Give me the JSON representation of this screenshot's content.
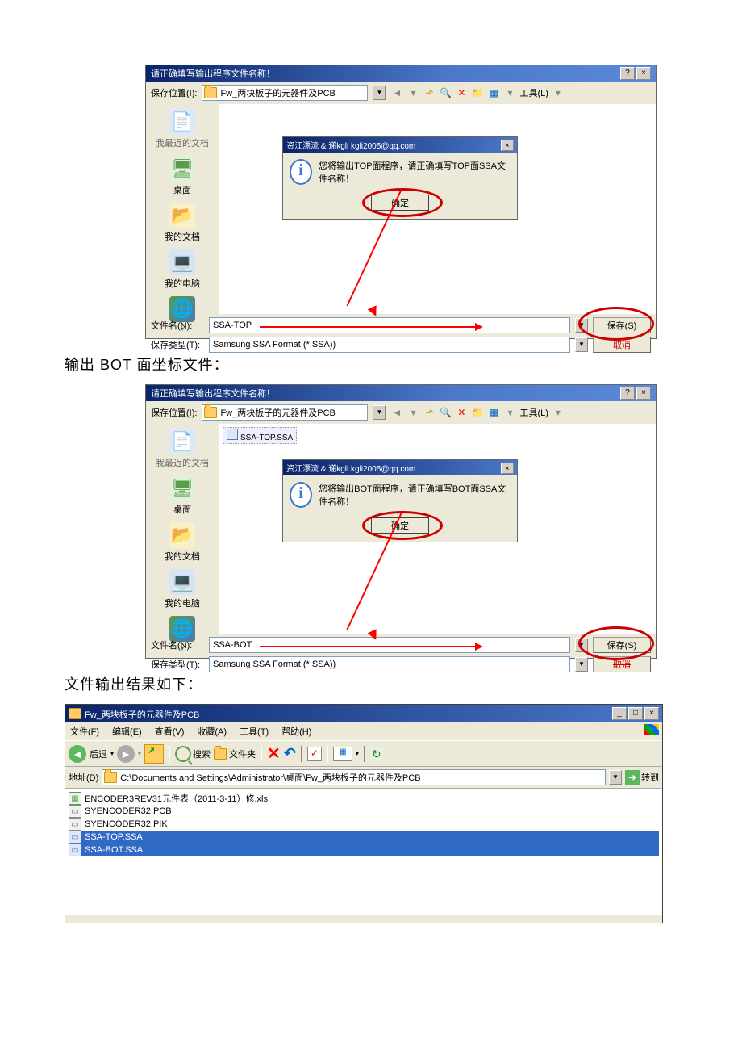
{
  "captions": {
    "bot_output": "输出 BOT 面坐标文件：",
    "file_result": "文件输出结果如下："
  },
  "dialog_top": {
    "title": "请正确填写输出程序文件名称！",
    "help": "?",
    "close": "×",
    "save_location_label": "保存位置(I):",
    "folder": "Fw_两块板子的元器件及PCB",
    "tools": "工具(L)",
    "sidebar": {
      "recent": "我最近的文档",
      "desktop": "桌面",
      "mydocs": "我的文档",
      "mycomp": "我的电脑"
    },
    "msgbox": {
      "title": "资江漂流 & 递kgli  kgli2005@qq.com",
      "text": "您将输出TOP面程序，请正确填写TOP面SSA文件名称！",
      "ok": "确定"
    },
    "filename_label": "文件名(N):",
    "filename_value": "SSA-TOP",
    "filetype_label": "保存类型(T):",
    "filetype_value": "Samsung SSA Format (*.SSA))",
    "save_btn": "保存(S)",
    "cancel_btn": "取消"
  },
  "dialog_bot": {
    "title": "请正确填写输出程序文件名称！",
    "save_location_label": "保存位置(I):",
    "folder": "Fw_两块板子的元器件及PCB",
    "tools": "工具(L)",
    "existing_file": "SSA-TOP.SSA",
    "sidebar": {
      "recent": "我最近的文档",
      "desktop": "桌面",
      "mydocs": "我的文档",
      "mycomp": "我的电脑"
    },
    "msgbox": {
      "title": "资江漂流 & 递kgli  kgli2005@qq.com",
      "text": "您将输出BOT面程序，请正确填写BOT面SSA文件名称！",
      "ok": "确定"
    },
    "filename_label": "文件名(N):",
    "filename_value": "SSA-BOT",
    "filetype_label": "保存类型(T):",
    "filetype_value": "Samsung SSA Format (*.SSA))",
    "save_btn": "保存(S)",
    "cancel_btn": "取消"
  },
  "explorer": {
    "title": "Fw_两块板子的元器件及PCB",
    "menu": {
      "file": "文件(F)",
      "edit": "编辑(E)",
      "view": "查看(V)",
      "fav": "收藏(A)",
      "tools": "工具(T)",
      "help": "帮助(H)"
    },
    "toolbar": {
      "back": "后退",
      "search": "搜索",
      "folders": "文件夹"
    },
    "address_label": "地址(D)",
    "address": "C:\\Documents and Settings\\Administrator\\桌面\\Fw_两块板子的元器件及PCB",
    "go": "转到",
    "files": [
      {
        "name": "ENCODER3REV31元件表（2011-3-11）修.xls",
        "type": "xls"
      },
      {
        "name": "SYENCODER32.PCB",
        "type": "pcb"
      },
      {
        "name": "SYENCODER32.PIK",
        "type": "pcb"
      },
      {
        "name": "SSA-TOP.SSA",
        "type": "ssa",
        "selected": true
      },
      {
        "name": "SSA-BOT.SSA",
        "type": "ssa",
        "selected": true
      }
    ]
  }
}
